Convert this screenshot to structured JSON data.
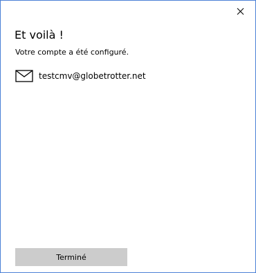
{
  "dialog": {
    "close_icon": "close-icon",
    "title": "Et voilà !",
    "subtitle": "Votre compte a été configuré."
  },
  "account": {
    "icon": "mail-icon",
    "email": "testcmv@globetrotter.net"
  },
  "actions": {
    "done_label": "Terminé"
  },
  "colors": {
    "window_border": "#4a7fd6",
    "button_background": "#cccccc",
    "background": "#ffffff",
    "text": "#000000"
  }
}
